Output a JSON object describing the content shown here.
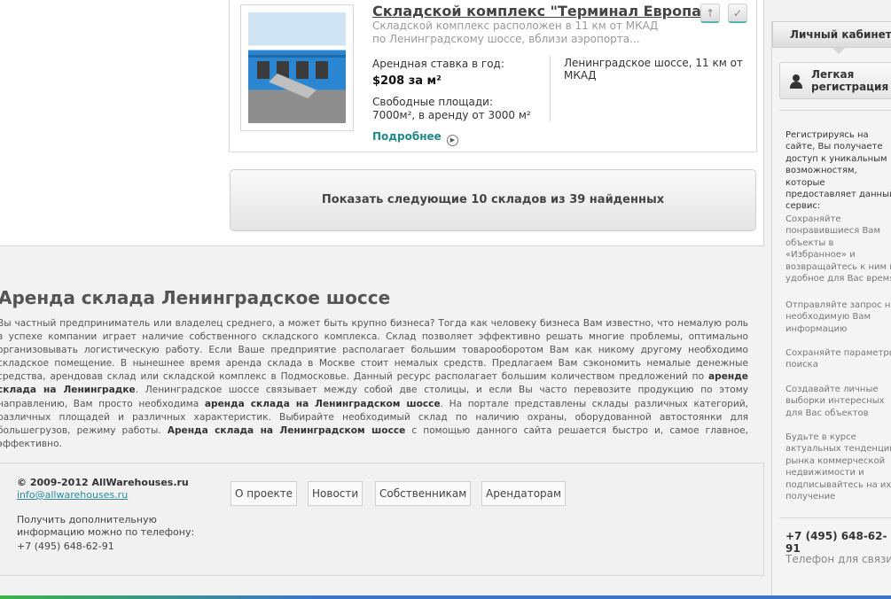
{
  "listing": {
    "title": "Складской комплекс \"Терминал Европа\"",
    "description": "Складской комплекс расположен в 11 км от МКАД по Ленинградскому шоссе, вблизи аэропорта...",
    "rate_label": "Арендная ставка в год:",
    "rate_value": "$208 за м²",
    "area_label": "Свободные площади:",
    "area_value": "7000м², в аренду от 3000 м²",
    "more_label": "Подробнее",
    "location": "Ленинградское шоссе, 11 км от МКАД",
    "btn_up_icon": "↑",
    "btn_check_icon": "✓",
    "more_arrow": "▶"
  },
  "show_more_label": "Показать следующие 10 складов из 39 найденных",
  "seo": {
    "title": "Аренда склада Ленинградское шоссе",
    "p1": "Вы частный предприниматель или владелец среднего, а может быть крупно бизнеса? Тогда как человеку бизнеса Вам известно, что немалую роль в успехе компании играет наличие собственного складского комплекса. Склад позволяет эффективно решать многие проблемы, оптимально организовывать логистическую работу. Если Ваше предприятие располагает большим товарооборотом Вам как никому другому необходимо складское помещение. В нынешнее время аренда склада в Москве стоит немалых средств. Предлагаем Вам сэкономить немалые денежные средства, арендовав склад или складской комплекс в Подмосковье. Данный ресурс располагает большим количеством предложений по",
    "b1": "аренде склада на Ленинградке",
    "p2": ". Ленинградское шоссе связывает между собой две столицы, и если Вы часто перевозите продукцию по этому направлению, Вам просто необходима",
    "b2": "аренда склада на Ленинградском шоссе",
    "p3": ". На портале представлены склады различных категорий, различных площадей и различных характеристик. Выбирайте необходимый склад по наличию охраны, оборудованной автостоянки для большегрузов, режиму работы.",
    "b3": "Аренда склада на Ленинградском шоссе",
    "p4": "с помощью данного сайта решается быстро и, самое главное, эффективно."
  },
  "footer": {
    "copyright": "© 2009-2012 AllWarehouses.ru",
    "email": "info@allwarehouses.ru",
    "info": "Получить дополнительную информацию можно по телефону:",
    "phone": "+7 (495) 648-62-91",
    "nav": [
      "О проекте",
      "Новости",
      "Собственникам",
      "Арендаторам"
    ]
  },
  "sidebar": {
    "tab_label": "Личный кабинет",
    "register_label": "Легкая регистрация",
    "intro": "Регистрируясь на сайте, Вы получаете доступ к уникальным возможностям, которые предоставляет данный сервис:",
    "benefits": [
      "Сохраняйте понравившиеся Вам объекты в «Избранное» и возвращайтесь к ним в удобное для Вас время",
      "Отправляйте запрос на необходимую Вам информацию",
      "Сохраняйте параметры поиска",
      "Создавайте личные выборки интересных для Вас объектов",
      "Будьте в курсе актуальных тенденций рынка коммерческой недвижимости и подписывайтесь на их получение"
    ],
    "phone": "+7 (495) 648-62-91",
    "phone_caption": "Телефон для связи"
  }
}
